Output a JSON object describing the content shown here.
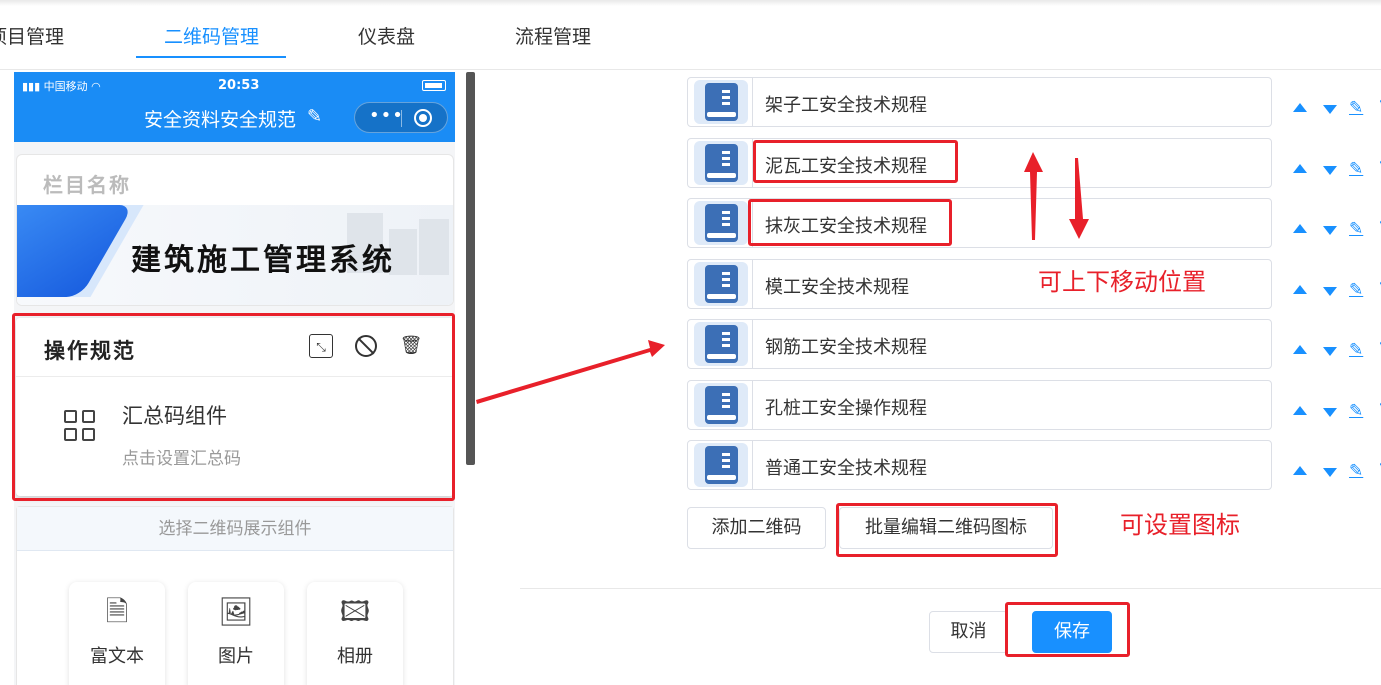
{
  "tabs": [
    {
      "label": "项目管理"
    },
    {
      "label": "二维码管理"
    },
    {
      "label": "仪表盘"
    },
    {
      "label": "流程管理"
    }
  ],
  "phone": {
    "carrier": "中国移动",
    "time": "20:53",
    "title": "安全资料安全规范",
    "column_name": "栏目名称",
    "banner_text": "建筑施工管理系统",
    "op_section": {
      "title": "操作规范",
      "component_name": "汇总码组件",
      "component_hint": "点击设置汇总码"
    },
    "select_title": "选择二维码展示组件",
    "components": [
      {
        "label": "富文本"
      },
      {
        "label": "图片"
      },
      {
        "label": "相册"
      }
    ]
  },
  "qr_list": [
    {
      "name": "架子工安全技术规程"
    },
    {
      "name": "泥瓦工安全技术规程"
    },
    {
      "name": "抹灰工安全技术规程"
    },
    {
      "name": "模工安全技术规程"
    },
    {
      "name": "钢筋工安全技术规程"
    },
    {
      "name": "孔桩工安全操作规程"
    },
    {
      "name": "普通工安全技术规程"
    }
  ],
  "buttons": {
    "add_qr": "添加二维码",
    "batch_edit": "批量编辑二维码图标",
    "cancel": "取消",
    "save": "保存"
  },
  "annotations": {
    "move_hint": "可上下移动位置",
    "icon_hint": "可设置图标"
  },
  "colors": {
    "accent": "#1890ff",
    "annotation_red": "#e8202a",
    "phone_header": "#1a8cf5"
  }
}
